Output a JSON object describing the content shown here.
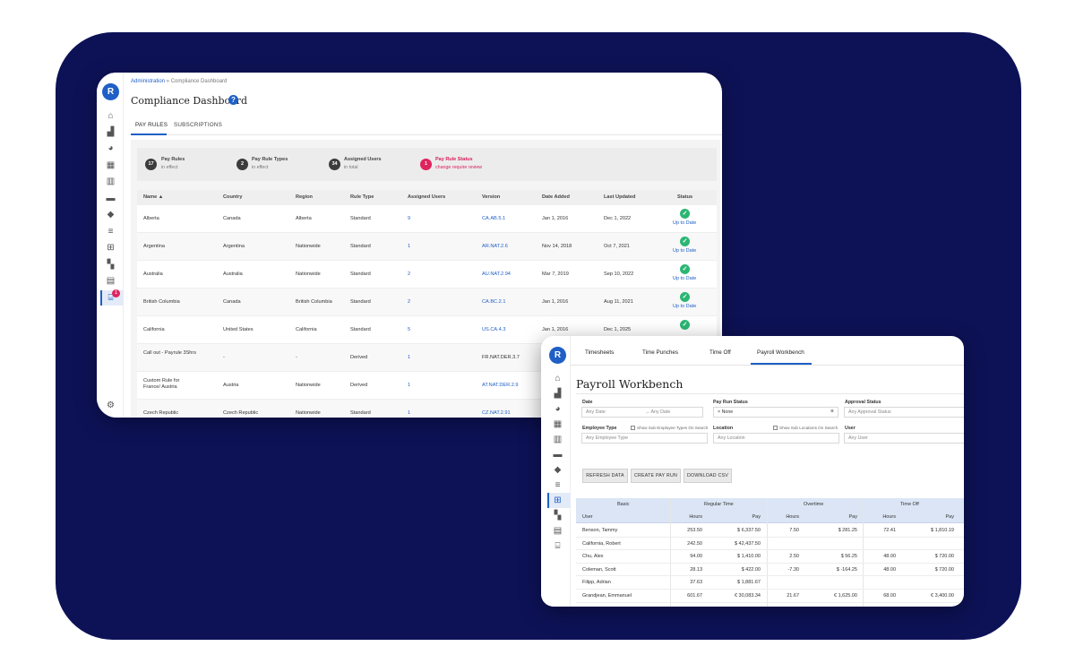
{
  "brand": {
    "logo_letter": "R",
    "accent": "#1f5fc6",
    "backdrop": "#0d1257",
    "success": "#2bb673",
    "alert": "#e0245e"
  },
  "compliance": {
    "rail_icons": [
      "home-icon",
      "chart-icon",
      "palette-icon",
      "calendar-icon",
      "building-icon",
      "folder-icon",
      "tag-icon",
      "list-icon",
      "hierarchy-icon",
      "dashboard-icon",
      "document-icon",
      "bank-icon",
      "gear-icon"
    ],
    "rail_badge": "1",
    "breadcrumb": {
      "root": "Administration",
      "sep": " » ",
      "current": "Compliance Dashboard"
    },
    "title": "Compliance Dashboard",
    "help_glyph": "?",
    "tabs": [
      "PAY RULES",
      "SUBSCRIPTIONS"
    ],
    "stats": [
      {
        "count": "17",
        "title": "Pay Rules",
        "sub": "in effect"
      },
      {
        "count": "2",
        "title": "Pay Rule Types",
        "sub": "in effect"
      },
      {
        "count": "34",
        "title": "Assigned Users",
        "sub": "in total"
      },
      {
        "count": "1",
        "title": "Pay Rule Status",
        "sub": "change require review"
      }
    ],
    "columns": [
      "Name ▲",
      "Country",
      "Region",
      "Rule Type",
      "Assigned Users",
      "Version",
      "Date Added",
      "Last Updated",
      "Status"
    ],
    "rows": [
      {
        "name": "Alberta",
        "country": "Canada",
        "region": "Alberta",
        "type": "Standard",
        "users": "9",
        "version": "CA.AB.5.1",
        "added": "Jan 1, 2016",
        "updated": "Dec 1, 2022",
        "status": "Up to Date"
      },
      {
        "name": "Argentina",
        "country": "Argentina",
        "region": "Nationwide",
        "type": "Standard",
        "users": "1",
        "version": "AR.NAT.2.6",
        "added": "Nov 14, 2018",
        "updated": "Oct 7, 2021",
        "status": "Up to Date"
      },
      {
        "name": "Australia",
        "country": "Australia",
        "region": "Nationwide",
        "type": "Standard",
        "users": "2",
        "version": "AU.NAT.2.94",
        "added": "Mar 7, 2019",
        "updated": "Sep 10, 2022",
        "status": "Up to Date"
      },
      {
        "name": "British Columbia",
        "country": "Canada",
        "region": "British Columbia",
        "type": "Standard",
        "users": "2",
        "version": "CA.BC.2.1",
        "added": "Jan 1, 2016",
        "updated": "Aug 11, 2021",
        "status": "Up to Date"
      },
      {
        "name": "California",
        "country": "United States",
        "region": "California",
        "type": "Standard",
        "users": "5",
        "version": "US.CA.4.3",
        "added": "Jan 1, 2016",
        "updated": "Dec 1, 2025",
        "status": ""
      },
      {
        "name": "Call out - Payrule 3Shrs",
        "country": "-",
        "region": "-",
        "type": "Derived",
        "users": "1",
        "version": "FR.NAT.DER.3.7",
        "added": "",
        "updated": "",
        "status": ""
      },
      {
        "name": "Custom Rule for France/ Austria",
        "country": "Austria",
        "region": "Nationwide",
        "type": "Derived",
        "users": "1",
        "version": "AT.NAT.DER.2.9",
        "added": "",
        "updated": "",
        "status": ""
      },
      {
        "name": "Czech Republic",
        "country": "Czech Republic",
        "region": "Nationwide",
        "type": "Standard",
        "users": "1",
        "version": "CZ.NAT.2.91",
        "added": "",
        "updated": "",
        "status": ""
      }
    ]
  },
  "payroll": {
    "rail_icons": [
      "home-icon",
      "chart-icon",
      "palette-icon",
      "calendar-icon",
      "building-icon",
      "folder-icon",
      "tag-icon",
      "list-icon",
      "hierarchy-icon",
      "dashboard-icon",
      "document-icon",
      "bank-icon"
    ],
    "tabs": [
      "Timesheets",
      "Time Punches",
      "Time Off",
      "Payroll Workbench"
    ],
    "title": "Payroll Workbench",
    "filters": {
      "date_label": "Date",
      "date_from": "Any Date",
      "date_to": "→ Any Date",
      "status_label": "Pay Run Status",
      "status_value": "× None",
      "status_clear": "×",
      "approval_label": "Approval Status",
      "approval_value": "Any Approval Status",
      "emp_type_label": "Employee Type",
      "emp_type_check": "Show Sub Employee Types On Search",
      "emp_type_value": "Any Employee Type",
      "location_label": "Location",
      "location_check": "Show Sub Locations On Search",
      "location_value": "Any Location",
      "user_label": "User",
      "user_value": "Any User"
    },
    "buttons": [
      "REFRESH DATA",
      "CREATE PAY RUN",
      "DOWNLOAD CSV"
    ],
    "groups": [
      "Basic",
      "Regular Time",
      "Overtime",
      "Time Off"
    ],
    "subheaders": [
      "User",
      "Hours",
      "Pay",
      "Hours",
      "Pay",
      "Hours",
      "Pay"
    ],
    "rows": [
      [
        "Benson, Tammy",
        "253.50",
        "$ 6,337.50",
        "7.50",
        "$ 281.25",
        "72.41",
        "$ 1,810.19"
      ],
      [
        "California, Robert",
        "242.50",
        "$ 42,437.50",
        "",
        "",
        "",
        ""
      ],
      [
        "Chu, Alex",
        "94.00",
        "$ 1,410.00",
        "2.50",
        "$ 56.25",
        "48.00",
        "$ 720.00"
      ],
      [
        "Coleman, Scott",
        "28.13",
        "$ 422.00",
        "-7.30",
        "$ -164.25",
        "48.00",
        "$ 720.00"
      ],
      [
        "Filipp, Adrian",
        "37.63",
        "$ 1,881.67",
        "",
        "",
        "",
        ""
      ],
      [
        "Grandjean, Emmanuel",
        "601.67",
        "€ 30,083.34",
        "21.67",
        "€ 1,625.00",
        "68.00",
        "€ 3,400.00"
      ]
    ]
  }
}
